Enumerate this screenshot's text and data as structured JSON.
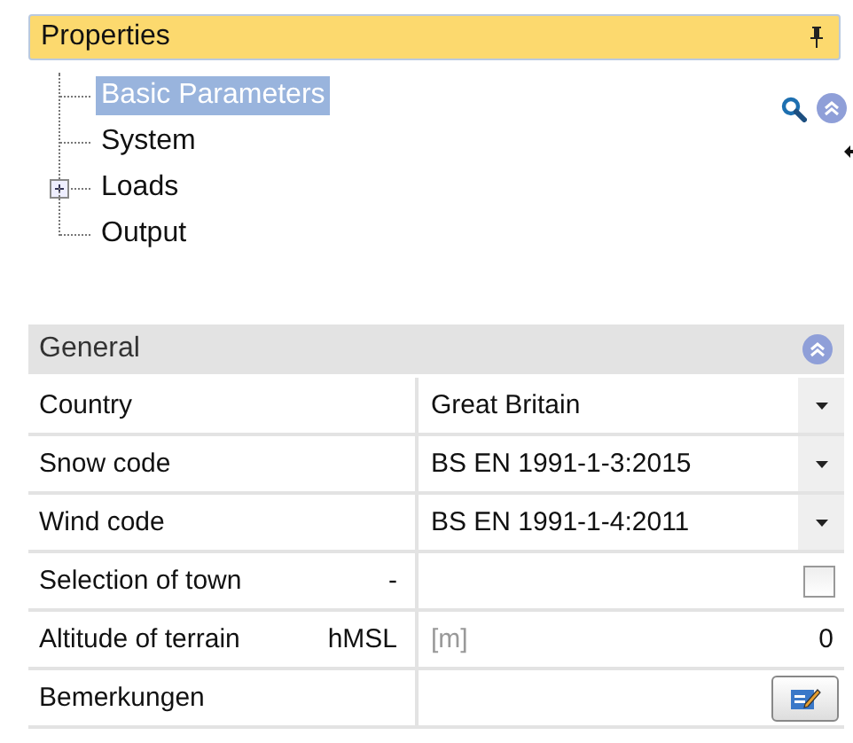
{
  "panel": {
    "title": "Properties"
  },
  "tree": [
    {
      "label": "Basic Parameters",
      "selected": true
    },
    {
      "label": "System",
      "selected": false
    },
    {
      "label": "Loads",
      "selected": false,
      "expanded": false
    },
    {
      "label": "Output",
      "selected": false
    }
  ],
  "section": {
    "title": "General",
    "expanded": true
  },
  "rows": [
    {
      "kind": "dropdown",
      "label": "Country",
      "value": "Great Britain"
    },
    {
      "kind": "dropdown",
      "label": "Snow code",
      "value": "BS EN 1991-1-3:2015"
    },
    {
      "kind": "dropdown",
      "label": "Wind code",
      "value": "BS EN 1991-1-4:2011"
    },
    {
      "kind": "checkbox",
      "label": "Selection of town",
      "symbol": "-",
      "checked": false
    },
    {
      "kind": "number",
      "label": "Altitude of terrain",
      "symbol": "hMSL",
      "unit": "[m]",
      "value": "0"
    },
    {
      "kind": "note",
      "label": "Bemerkungen"
    }
  ]
}
